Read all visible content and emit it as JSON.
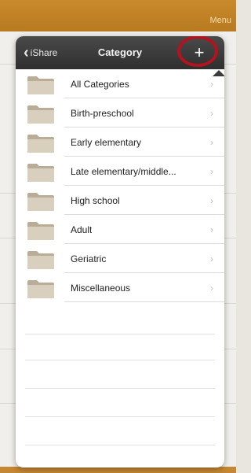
{
  "app": {
    "menu_label": "Menu"
  },
  "popover": {
    "back_label": "iShare",
    "title": "Category",
    "add_label": "+"
  },
  "categories": [
    {
      "label": "All Categories"
    },
    {
      "label": "Birth-preschool"
    },
    {
      "label": "Early elementary"
    },
    {
      "label": "Late elementary/middle..."
    },
    {
      "label": "High school"
    },
    {
      "label": "Adult"
    },
    {
      "label": "Geriatric"
    },
    {
      "label": "Miscellaneous"
    }
  ],
  "icons": {
    "folder": "folder-icon",
    "chevron": "chevron-right-icon",
    "back": "chevron-left-icon"
  },
  "colors": {
    "topbar": "#c98a2c",
    "navbar": "#3a3a3a",
    "highlight_ring": "#b3121f"
  }
}
